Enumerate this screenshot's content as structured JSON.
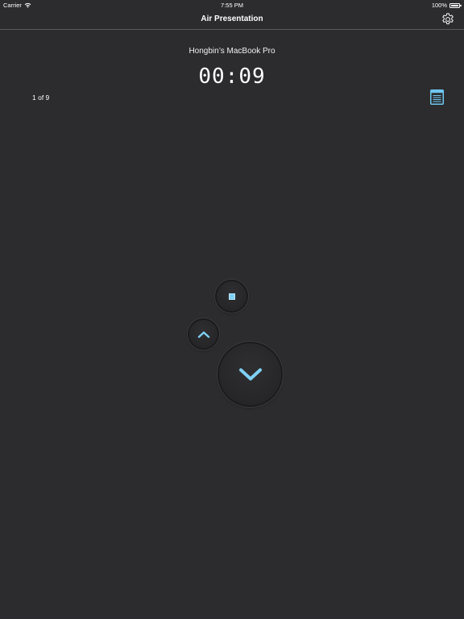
{
  "status_bar": {
    "carrier": "Carrier",
    "time": "7:55 PM",
    "battery_text": "100%",
    "battery_level": 1.0
  },
  "nav": {
    "title": "Air Presentation",
    "settings_icon": "gear-icon"
  },
  "presentation": {
    "device_name": "Hongbin’s MacBook Pro",
    "timer": "00:09",
    "page_counter": "1 of 9",
    "notes_icon": "notes-icon"
  },
  "controls": {
    "stop_icon": "stop-icon",
    "previous_icon": "chevron-up-icon",
    "next_icon": "chevron-down-icon"
  },
  "colors": {
    "background": "#2c2c2e",
    "accent": "#7fd0f5",
    "text": "#ffffff"
  }
}
